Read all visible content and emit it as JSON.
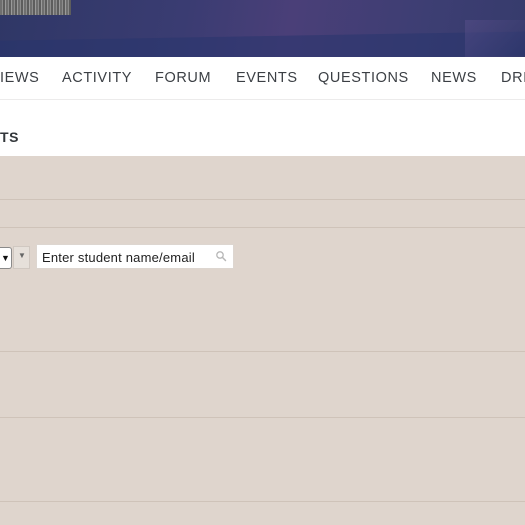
{
  "nav": {
    "items": [
      "IEWS",
      "ACTIVITY",
      "FORUM",
      "EVENTS",
      "QUESTIONS",
      "NEWS",
      "DRI"
    ]
  },
  "subheader": {
    "label": "TS"
  },
  "filter": {
    "search_value": "Enter student name/email"
  },
  "colors": {
    "banner": "#3a3c72",
    "page_background": "#dfd5cd",
    "nav_text": "#3b3f44"
  }
}
